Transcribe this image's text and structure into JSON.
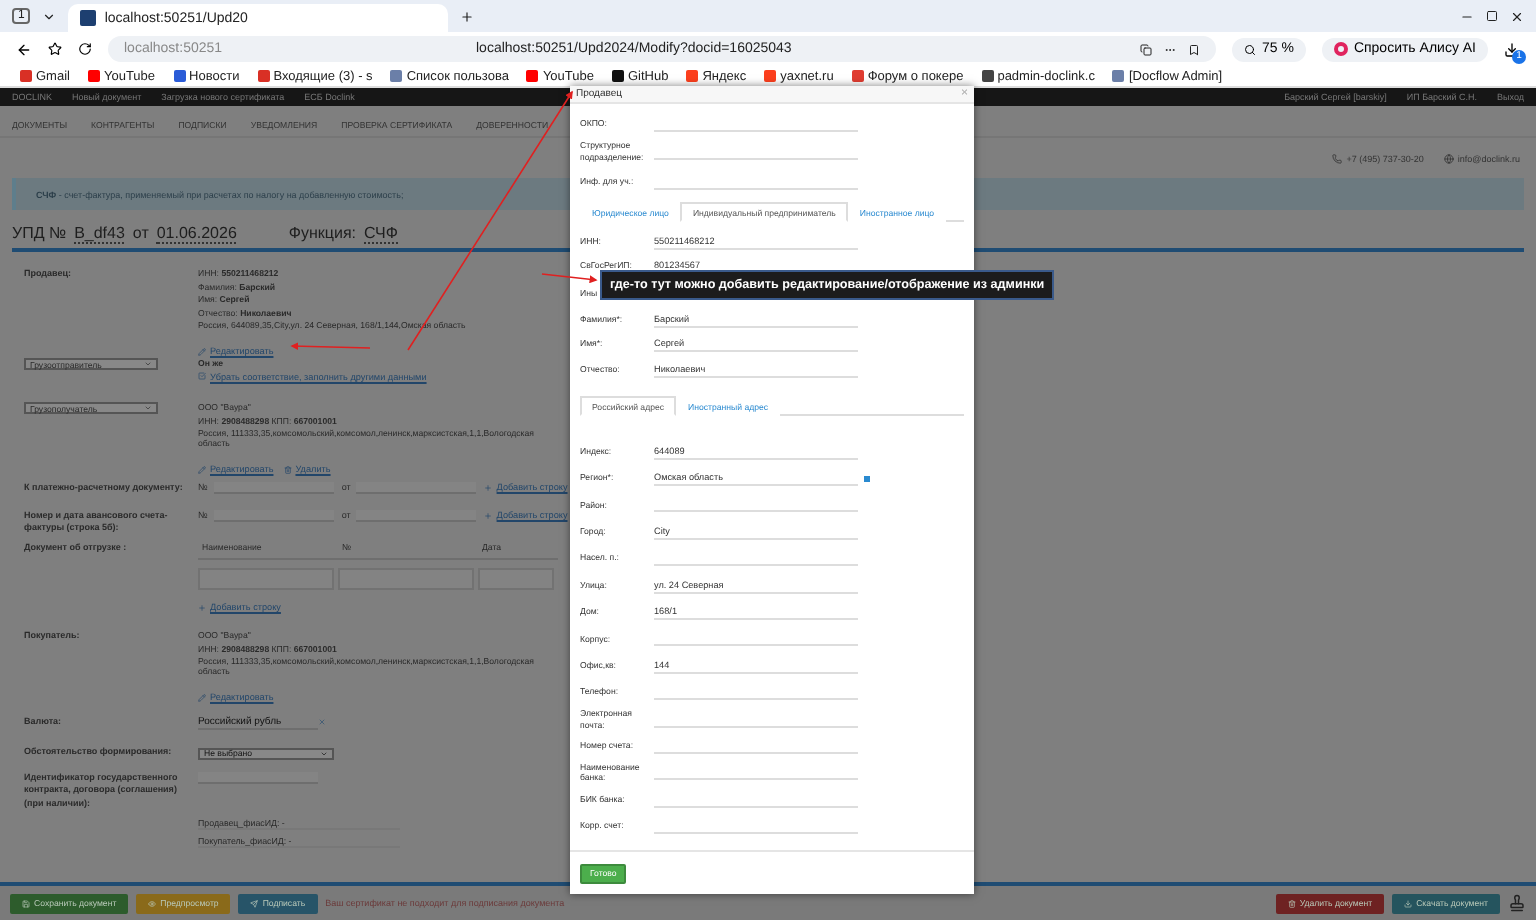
{
  "browser": {
    "tab_count": "1",
    "tab_title": "localhost:50251/Upd20",
    "host_hint": "localhost:50251",
    "url": "localhost:50251/Upd2024/Modify?docid=16025043",
    "zoom": "75 %",
    "alice": "Спросить Алису AI",
    "ext_badge": "1",
    "bookmarks": [
      {
        "label": "Gmail",
        "color": "#d93025"
      },
      {
        "label": "YouTube",
        "color": "#ff0000"
      },
      {
        "label": "Новости",
        "color": "#2a5bd7"
      },
      {
        "label": "Входящие (3) - s",
        "color": "#d93025"
      },
      {
        "label": "Список пользова",
        "color": "#6b7fa8"
      },
      {
        "label": "YouTube",
        "color": "#ff0000"
      },
      {
        "label": "GitHub",
        "color": "#111111"
      },
      {
        "label": "Яндекс",
        "color": "#fc3f1d"
      },
      {
        "label": "yaxnet.ru",
        "color": "#fc3f1d"
      },
      {
        "label": "Форум о покере",
        "color": "#e03c31"
      },
      {
        "label": "padmin-doclink.c",
        "color": "#444444"
      },
      {
        "label": "[Docflow Admin]",
        "color": "#6b7fa8"
      }
    ]
  },
  "app_nav": {
    "brand": "DOCLINK",
    "items": [
      "Новый документ",
      "Загрузка нового сертификата",
      "ЕСБ Doclink"
    ],
    "user": "Барский Сергей [barskiy]",
    "org": "ИП Барский С.Н.",
    "logout": "Выход"
  },
  "menu": [
    "ДОКУМЕНТЫ",
    "КОНТРАГЕНТЫ",
    "ПОДПИСКИ",
    "УВЕДОМЛЕНИЯ",
    "ПРОВЕРКА СЕРТИФИКАТА",
    "ДОВЕРЕННОСТИ"
  ],
  "contacts": {
    "phone": "+7 (495) 737-30-20",
    "email": "info@doclink.ru"
  },
  "info": "**СЧФ** - счет-фактура, применяемый при расчетах по налогу на добавленную стоимость;",
  "doc": {
    "title": "УПД №",
    "number": "В_df43",
    "from": "от",
    "date": "01.06.2026",
    "function_label": "Функция:",
    "function_value": "СЧФ"
  },
  "seller": {
    "label": "Продавец:",
    "lines": [
      "ИНН: **550211468212**",
      "Фамилия: **Барский**",
      "Имя: **Сергей**",
      "Отчество: **Николаевич**",
      "Россия, 644089,35,City,ул. 24 Северная, 168/1,144,Омская область"
    ],
    "edit": "Редактировать"
  },
  "shipper": {
    "select": "Грузоотправитель",
    "same": "Он же",
    "link": "Убрать соответствие, заполнить другими данными"
  },
  "consignee": {
    "select": "Грузополучатель",
    "lines": [
      "ООО \"Ваура\"",
      "ИНН: **2908488298** КПП: **667001001**",
      "Россия, 111333,35,комсомольский,комсомол,ленинск,марксистская,1,1,Вологодская область"
    ],
    "edit": "Редактировать",
    "delete": "Удалить"
  },
  "payment_doc": {
    "label": "К платежно-расчетному документу:",
    "no": "№",
    "from": "от",
    "add": "Добавить строку"
  },
  "advance_invoice": {
    "label": "Номер и дата авансового счета-фактуры (строка 5б):",
    "no": "№",
    "from": "от",
    "add": "Добавить строку"
  },
  "shipment_doc": {
    "label": "Документ об отгрузке :",
    "columns": [
      "Наименование",
      "№",
      "Дата"
    ],
    "add": "Добавить строку"
  },
  "buyer": {
    "label": "Покупатель:",
    "lines": [
      "ООО \"Ваура\"",
      "ИНН: **2908488298** КПП: **667001001**",
      "Россия, 111333,35,комсомольский,комсомол,ленинск,марксистская,1,1,Вологодская область"
    ],
    "edit": "Редактировать"
  },
  "currency": {
    "label": "Валюта:",
    "value": "Российский рубль"
  },
  "circumstance": {
    "label": "Обстоятельство формирования:",
    "value": "Не выбрано"
  },
  "contract_id": {
    "label": "Идентификатор государственного контракта, договора (соглашения) (при наличии):"
  },
  "fias": [
    "Продавец_фиасИД: -",
    "Покупатель_фиасИД: -"
  ],
  "footer": {
    "left": [
      {
        "label": "Сохранить документ",
        "kind": "save"
      },
      {
        "label": "Предпросмотр",
        "kind": "preview"
      },
      {
        "label": "Подписать",
        "kind": "sign"
      }
    ],
    "warning": "Ваш сертификат не подходит для подписания документа",
    "right": [
      {
        "label": "Удалить документ",
        "kind": "delete"
      },
      {
        "label": "Скачать документ",
        "kind": "download"
      }
    ]
  },
  "modal": {
    "title": "Продавец",
    "close": "×",
    "top_fields": [
      {
        "label": "ОКПО:"
      },
      {
        "label": "Структурное подразделение:"
      },
      {
        "label": "Инф. для уч.:"
      }
    ],
    "tabs": [
      {
        "label": "Юридическое лицо",
        "selected": false
      },
      {
        "label": "Индивидуальный предприниматель",
        "selected": true
      },
      {
        "label": "Иностранное лицо",
        "selected": false
      }
    ],
    "entity_fields": [
      {
        "label": "ИНН:",
        "value": "550211468212"
      },
      {
        "label": "СвГосРегИП:",
        "value": "801234567"
      },
      {
        "label": "Ины"
      },
      {
        "label": "Фамилия*:",
        "value": "Барский"
      },
      {
        "label": "Имя*:",
        "value": "Сергей"
      },
      {
        "label": "Отчество:",
        "value": "Николаевич"
      }
    ],
    "address_tabs": [
      {
        "label": "Российский адрес",
        "selected": true
      },
      {
        "label": "Иностранный адрес",
        "selected": false
      }
    ],
    "address_fields": [
      {
        "label": "Индекс:",
        "value": "644089"
      },
      {
        "label": "Регион*:",
        "value": "Омская область",
        "kind": "picker"
      },
      {
        "label": "Район:"
      },
      {
        "label": "Город:",
        "value": "City"
      },
      {
        "label": "Насел. п.:"
      },
      {
        "label": "Улица:",
        "value": "ул. 24 Северная"
      },
      {
        "label": "Дом:",
        "value": "168/1"
      },
      {
        "label": "Корпус:"
      },
      {
        "label": "Офис,кв:",
        "value": "144"
      },
      {
        "label": "Телефон:"
      },
      {
        "label": "Электронная почта:"
      },
      {
        "label": "Номер счета:"
      },
      {
        "label": "Наименование банка:"
      },
      {
        "label": "БИК банка:"
      },
      {
        "label": "Корр. счет:"
      }
    ],
    "done": "Готово"
  },
  "note": "где-то тут можно добавить редактирование/отображение из админки"
}
